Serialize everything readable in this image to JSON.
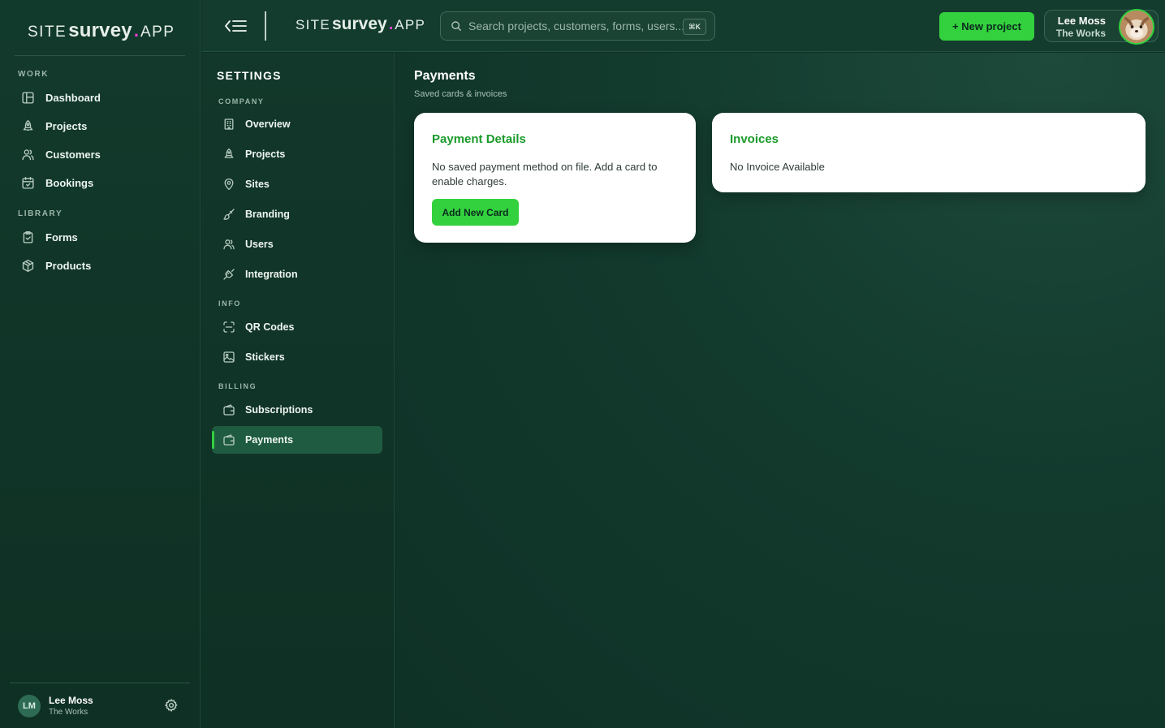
{
  "brand": {
    "site": "SITE",
    "survey": "survey",
    "dot": ".",
    "app": "APP"
  },
  "sidebar": {
    "sections": [
      {
        "label": "WORK",
        "items": [
          {
            "label": "Dashboard",
            "icon": "dashboard-icon"
          },
          {
            "label": "Projects",
            "icon": "rocket-icon"
          },
          {
            "label": "Customers",
            "icon": "users-icon"
          },
          {
            "label": "Bookings",
            "icon": "calendar-icon"
          }
        ]
      },
      {
        "label": "LIBRARY",
        "items": [
          {
            "label": "Forms",
            "icon": "clipboard-icon"
          },
          {
            "label": "Products",
            "icon": "box-icon"
          }
        ]
      }
    ],
    "user": {
      "initials": "LM",
      "name": "Lee Moss",
      "org": "The Works"
    }
  },
  "topbar": {
    "search_placeholder": "Search projects, customers, forms, users...",
    "shortcut": "⌘K",
    "new_project_label": "+ New project",
    "user": {
      "name": "Lee Moss",
      "org": "The Works"
    }
  },
  "settings": {
    "title": "SETTINGS",
    "sections": [
      {
        "label": "COMPANY",
        "items": [
          "Overview",
          "Projects",
          "Sites",
          "Branding",
          "Users",
          "Integration"
        ]
      },
      {
        "label": "INFO",
        "items": [
          "QR Codes",
          "Stickers"
        ]
      },
      {
        "label": "BILLING",
        "items": [
          "Subscriptions",
          "Payments"
        ]
      }
    ],
    "active": "Payments"
  },
  "main": {
    "title": "Payments",
    "subtitle": "Saved cards & invoices",
    "payment_card": {
      "title": "Payment Details",
      "text_line1": "No saved payment method on file. Add a card to",
      "text_line2": "enable charges.",
      "button": "Add New Card"
    },
    "invoice_card": {
      "title": "Invoices",
      "text": "No Invoice Available"
    }
  },
  "colors": {
    "accent": "#33d13d",
    "brand_dot": "#e83fd3",
    "background": "#0f2f24",
    "card_title": "#1a9a2a"
  }
}
